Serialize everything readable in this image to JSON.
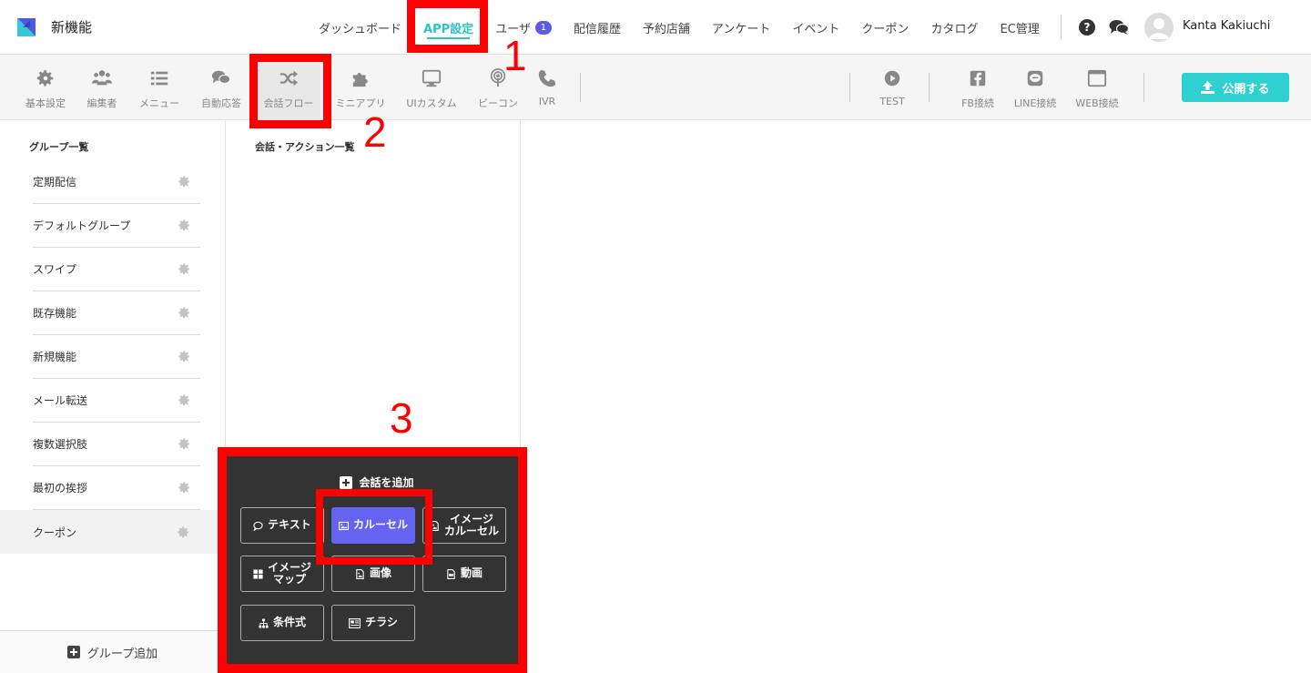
{
  "app": {
    "name": "新機能"
  },
  "nav": {
    "items": [
      {
        "label": "ダッシュボード",
        "active": false
      },
      {
        "label": "APP設定",
        "active": true
      },
      {
        "label": "ユーザ",
        "badge": "1",
        "active": false
      },
      {
        "label": "配信履歴",
        "active": false
      },
      {
        "label": "予約店舗",
        "active": false
      },
      {
        "label": "アンケート",
        "active": false
      },
      {
        "label": "イベント",
        "active": false
      },
      {
        "label": "クーポン",
        "active": false
      },
      {
        "label": "カタログ",
        "active": false
      },
      {
        "label": "EC管理",
        "active": false
      }
    ],
    "help_glyph": "?",
    "user_name": "Kanta Kakiuchi"
  },
  "toolbar": {
    "tools": [
      {
        "label": "基本設定",
        "icon": "gear-icon"
      },
      {
        "label": "編集者",
        "icon": "users-icon"
      },
      {
        "label": "メニュー",
        "icon": "list-icon"
      },
      {
        "label": "自動応答",
        "icon": "chat-icon"
      },
      {
        "label": "会話フロー",
        "icon": "shuffle-icon"
      },
      {
        "label": "ミニアプリ",
        "icon": "puzzle-icon"
      },
      {
        "label": "UIカスタム",
        "icon": "monitor-icon"
      },
      {
        "label": "ビーコン",
        "icon": "beacon-icon"
      },
      {
        "label": "IVR",
        "icon": "phone-icon"
      }
    ],
    "right_tools": [
      {
        "label": "TEST",
        "icon": "play-icon"
      },
      {
        "label": "FB接続",
        "icon": "facebook-icon"
      },
      {
        "label": "LINE接続",
        "icon": "line-icon"
      },
      {
        "label": "WEB接続",
        "icon": "window-icon"
      }
    ],
    "publish_label": "公開する"
  },
  "sidebar": {
    "title": "グループ一覧",
    "groups": [
      {
        "label": "定期配信"
      },
      {
        "label": "デフォルトグループ"
      },
      {
        "label": "スワイプ"
      },
      {
        "label": "既存機能"
      },
      {
        "label": "新規機能"
      },
      {
        "label": "メール転送"
      },
      {
        "label": "複数選択肢"
      },
      {
        "label": "最初の挨拶"
      },
      {
        "label": "クーポン",
        "selected": true
      }
    ],
    "add_group_label": "グループ追加"
  },
  "middle": {
    "title": "会話・アクション一覧"
  },
  "add_conversation": {
    "title": "会話を追加",
    "actions": [
      {
        "label": "テキスト",
        "icon": "comment-icon"
      },
      {
        "label": "カルーセル",
        "icon": "image-icon",
        "primary": true
      },
      {
        "label": "イメージ カルーセル",
        "icon": "file-image-icon"
      },
      {
        "label": "イメージ マップ",
        "icon": "grid-icon"
      },
      {
        "label": "画像",
        "icon": "image-file-icon"
      },
      {
        "label": "動画",
        "icon": "video-file-icon"
      },
      {
        "label": "条件式",
        "icon": "sitemap-icon"
      },
      {
        "label": "チラシ",
        "icon": "newspaper-icon"
      }
    ]
  },
  "annotations": [
    "1",
    "2",
    "3"
  ],
  "colors": {
    "accent": "#2ec4c8",
    "publish": "#2ed1cf",
    "badge": "#5b5be6",
    "primary_action": "#6464f0",
    "annotation": "#ff0000",
    "panel": "#333333"
  }
}
